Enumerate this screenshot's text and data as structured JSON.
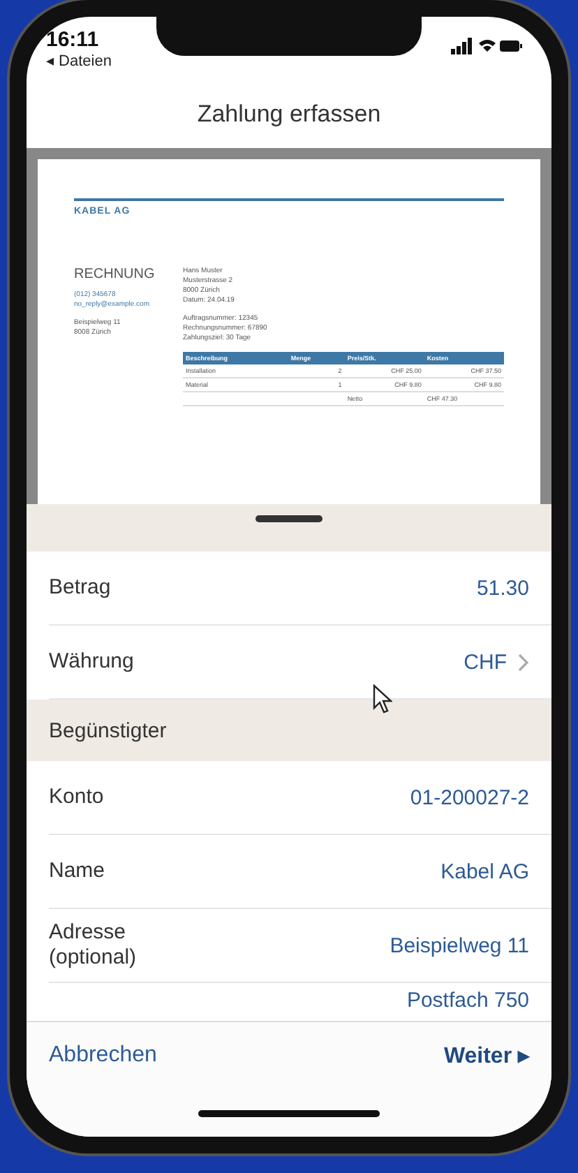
{
  "status_bar": {
    "time": "16:11",
    "back_link": "◂ Dateien"
  },
  "nav": {
    "title": "Zahlung erfassen"
  },
  "document": {
    "company": "KABEL AG",
    "heading": "RECHNUNG",
    "contact": [
      "(012) 345678",
      "no_reply@example.com"
    ],
    "sender_address": [
      "Beispielweg 11",
      "8008 Zürich"
    ],
    "recipient": [
      "Hans Muster",
      "Musterstrasse 2",
      "8000 Zürich",
      "Datum: 24.04.19"
    ],
    "references": [
      "Auftragsnummer: 12345",
      "Rechnungsnummer: 67890",
      "Zahlungsziel: 30 Tage"
    ],
    "table": {
      "columns": [
        "Beschreibung",
        "Menge",
        "Preis/Stk.",
        "Kosten"
      ],
      "rows": [
        [
          "Installation",
          "2",
          "CHF 25.00",
          "CHF 37.50"
        ],
        [
          "Material",
          "1",
          "CHF 9.80",
          "CHF 9.80"
        ]
      ],
      "total_label": "Netto",
      "total": "CHF 47.30"
    }
  },
  "form": [
    {
      "kind": "row",
      "label": "Betrag",
      "value": "51.30",
      "disclosure": false
    },
    {
      "kind": "row",
      "label": "Währung",
      "value": "CHF",
      "disclosure": true
    },
    {
      "kind": "section",
      "label": "Begünstigter"
    },
    {
      "kind": "row",
      "label": "Konto",
      "value": "01-200027-2",
      "disclosure": false
    },
    {
      "kind": "row",
      "label": "Name",
      "value": "Kabel AG",
      "disclosure": false
    },
    {
      "kind": "row",
      "label": "Adresse\n(optional)",
      "value": "Beispielweg 11",
      "disclosure": false
    },
    {
      "kind": "row",
      "value": "Postfach 750",
      "disclosure": false
    }
  ],
  "toolbar": {
    "cancel": "Abbrechen",
    "next": "Weiter ▸"
  }
}
